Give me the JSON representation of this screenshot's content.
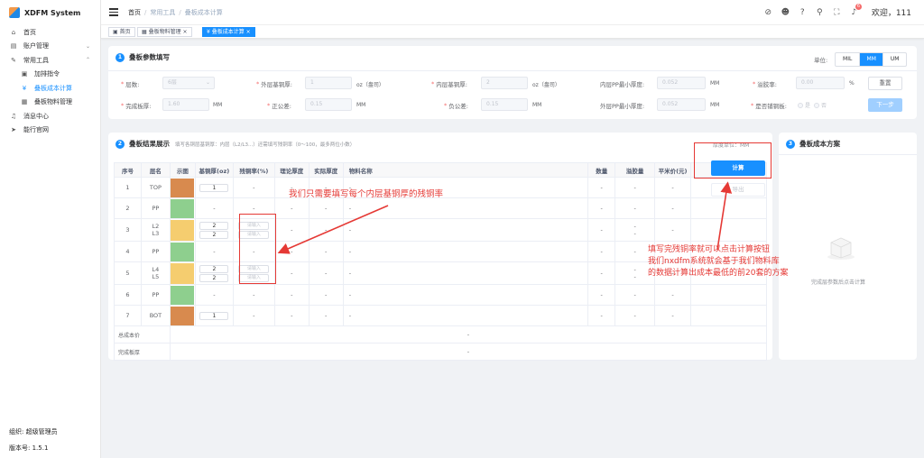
{
  "app": {
    "title": "XDFM System"
  },
  "sidebar": {
    "items": [
      {
        "label": "首页",
        "icon": "home-icon"
      },
      {
        "label": "账户管理",
        "icon": "user-icon"
      },
      {
        "label": "常用工具",
        "icon": "tools-icon"
      },
      {
        "label": "加排指令",
        "icon": "monitor-icon"
      },
      {
        "label": "叠板成本计算",
        "icon": "yen-icon"
      },
      {
        "label": "叠板物料管理",
        "icon": "grid-icon"
      },
      {
        "label": "消息中心",
        "icon": "bell-icon"
      },
      {
        "label": "能行官网",
        "icon": "send-icon"
      }
    ],
    "org": "组织: 超级管理员",
    "version": "版本号: 1.5.1"
  },
  "header": {
    "breadcrumb": [
      "首页",
      "常用工具",
      "叠板成本计算"
    ],
    "welcome": "欢迎，111",
    "notice_count": "6"
  },
  "tags": [
    "首页",
    "叠板物料管理",
    "叠板成本计算"
  ],
  "params": {
    "title": "叠板参数填写",
    "unit_label": "单位:",
    "units": [
      "MIL",
      "MM",
      "UM"
    ],
    "unit_selected": "MM",
    "layers_label": "层数:",
    "layers_value": "6层",
    "outer_cu_label": "外层基铜厚:",
    "outer_cu_value": "1",
    "outer_cu_unit": "oz（盎司）",
    "inner_cu_label": "内层基铜厚:",
    "inner_cu_value": "2",
    "inner_cu_unit": "oz（盎司）",
    "inner_pp_label": "内层PP最小厚度:",
    "inner_pp_value": "0.052",
    "inner_pp_unit": "MM",
    "overflow_label": "溢胶率:",
    "overflow_value": "0.00",
    "overflow_unit": "%",
    "finish_label": "完成板厚:",
    "finish_value": "1.60",
    "finish_unit": "MM",
    "pos_tol_label": "正公差:",
    "pos_tol_value": "0.15",
    "pos_tol_unit": "MM",
    "neg_tol_label": "负公差:",
    "neg_tol_value": "0.15",
    "neg_tol_unit": "MM",
    "outer_pp_label": "外层PP最小厚度:",
    "outer_pp_value": "0.052",
    "outer_pp_unit": "MM",
    "blind_label": "是否铺铜板:",
    "blind_yes": "是",
    "blind_no": "否",
    "reset": "重置",
    "next": "下一步"
  },
  "result": {
    "title": "叠板结果展示",
    "hint": "填写各铜层基铜厚：内层（L2/L3...）还需填写残铜率（0～100，最多两位小数）",
    "thick_unit": "厚度单位：MM",
    "columns": [
      "序号",
      "层名",
      "示图",
      "基铜厚(oz)",
      "残铜率(%)",
      "理论厚度",
      "实际厚度",
      "物料名称",
      "数量",
      "溢胶量",
      "平米价(元)"
    ],
    "rows": [
      {
        "no": "1",
        "names": [
          "TOP"
        ],
        "color": "#d88a4e",
        "cu": [
          "1"
        ],
        "rate": [
          "-"
        ]
      },
      {
        "no": "2",
        "names": [
          "PP"
        ],
        "color": "#8ecf8e",
        "cu": [
          "-"
        ],
        "rate": [
          "-"
        ]
      },
      {
        "no": "3",
        "names": [
          "L2",
          "L3"
        ],
        "color": "#f5cd6f",
        "cu": [
          "2",
          "2"
        ],
        "rate": [
          "请输入",
          "请输入"
        ]
      },
      {
        "no": "4",
        "names": [
          "PP"
        ],
        "color": "#8ecf8e",
        "cu": [
          "-"
        ],
        "rate": [
          "-"
        ]
      },
      {
        "no": "5",
        "names": [
          "L4",
          "L5"
        ],
        "color": "#f5cd6f",
        "cu": [
          "2",
          "2"
        ],
        "rate": [
          "请输入",
          "请输入"
        ]
      },
      {
        "no": "6",
        "names": [
          "PP"
        ],
        "color": "#8ecf8e",
        "cu": [
          "-"
        ],
        "rate": [
          "-"
        ]
      },
      {
        "no": "7",
        "names": [
          "BOT"
        ],
        "color": "#d88a4e",
        "cu": [
          "1"
        ],
        "rate": [
          "-"
        ]
      }
    ],
    "total_cost_label": "总成本价",
    "total_cost_value": "-",
    "finish_thick_label": "完成板厚",
    "finish_thick_value": "-",
    "calc": "计算",
    "export": "导出"
  },
  "plan": {
    "title": "叠板成本方案",
    "empty": "完成层参数后点击计算"
  },
  "annotations": {
    "a1": "我们只需要填写每个内层基铜厚的残铜率",
    "a2_l1": "填写完残铜率就可以点击计算按钮",
    "a2_l2": "我们nxdfm系统就会基于我们物料库",
    "a2_l3": "的数据计算出成本最低的前20套的方案"
  },
  "colors": {
    "primary": "#1890ff",
    "annotation": "#e53935"
  }
}
